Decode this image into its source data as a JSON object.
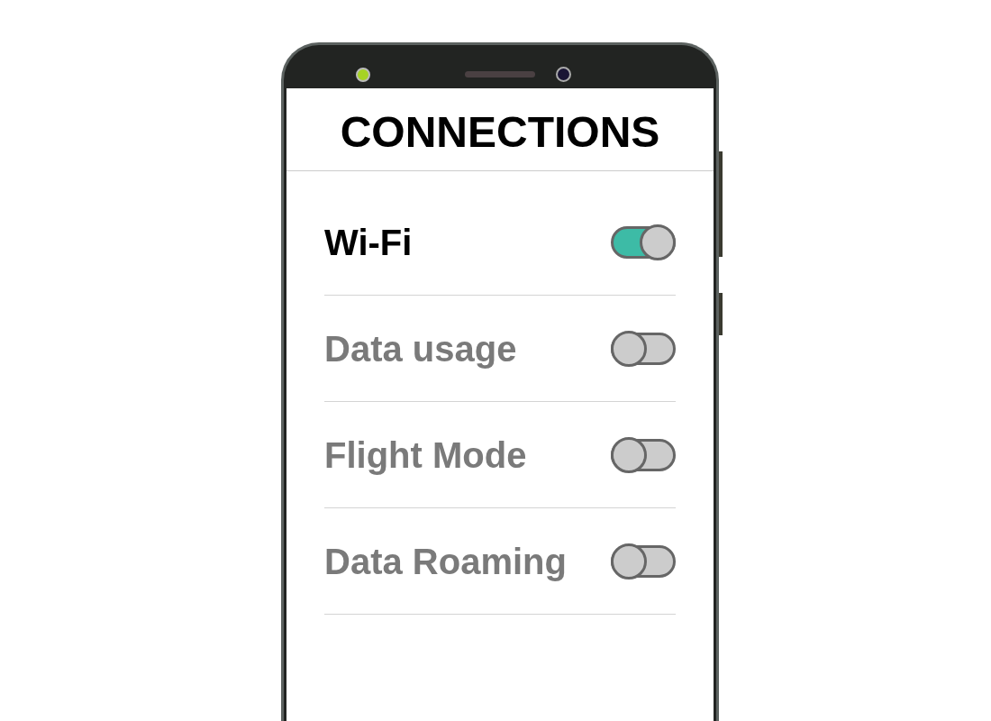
{
  "title": "CONNECTIONS",
  "items": [
    {
      "label": "Wi-Fi",
      "on": true
    },
    {
      "label": "Data usage",
      "on": false
    },
    {
      "label": "Flight Mode",
      "on": false
    },
    {
      "label": "Data Roaming",
      "on": false
    }
  ]
}
